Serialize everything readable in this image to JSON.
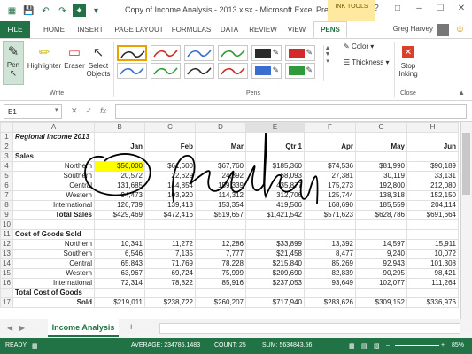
{
  "title_bar": {
    "doc_title": "Copy of Income Analysis - 2013.xlsx - Microsoft Excel Preview",
    "ink_tools": "INK TOOLS",
    "help": "?",
    "minimize": "–",
    "restore": "☐",
    "close": "✕"
  },
  "tabs": [
    "FILE",
    "HOME",
    "INSERT",
    "PAGE LAYOUT",
    "FORMULAS",
    "DATA",
    "REVIEW",
    "VIEW",
    "PENS"
  ],
  "user": "Greg Harvey",
  "ribbon": {
    "pen": "Pen",
    "highlighter": "Highlighter",
    "eraser": "Eraser",
    "select_objects_1": "Select",
    "select_objects_2": "Objects",
    "write_group": "Write",
    "pens_group": "Pens",
    "color": "Color",
    "thickness": "Thickness",
    "stop_inking_1": "Stop",
    "stop_inking_2": "Inking",
    "close_group": "Close",
    "pen_colors": [
      "#2b2b2b",
      "#d22a2a",
      "#3a6fd0",
      "#2e9a3a",
      "#2b2b2b",
      "#d22a2a",
      "#3a6fd0",
      "#2e9a3a",
      "#2b2b2b",
      "#d22a2a",
      "#3a6fd0",
      "#2e9a3a",
      "#ffff00",
      "#00e5ff",
      "#ff00ff",
      "#00e000",
      "#ff0000"
    ]
  },
  "formula_bar": {
    "name_box": "E1",
    "cancel": "✕",
    "enter": "✓",
    "fx": "fx"
  },
  "grid": {
    "columns": [
      "A",
      "B",
      "C",
      "D",
      "E",
      "F",
      "G",
      "H"
    ],
    "rows": [
      {
        "n": "1",
        "cells": [
          "Regional Income 2013",
          "",
          "",
          "",
          "",
          "",
          "",
          ""
        ]
      },
      {
        "n": "2",
        "cells": [
          "",
          "Jan",
          "Feb",
          "Mar",
          "Qtr 1",
          "Apr",
          "May",
          "Jun"
        ]
      },
      {
        "n": "3",
        "cells": [
          "Sales",
          "",
          "",
          "",
          "",
          "",
          "",
          ""
        ]
      },
      {
        "n": "4",
        "cells": [
          "Northern",
          "$56,000",
          "$61,600",
          "$67,760",
          "$185,360",
          "$74,536",
          "$81,990",
          "$90,189"
        ]
      },
      {
        "n": "5",
        "cells": [
          "Southern",
          "20,572",
          "22,629",
          "24,892",
          "68,093",
          "27,381",
          "30,119",
          "33,131"
        ]
      },
      {
        "n": "6",
        "cells": [
          "Central",
          "131,685",
          "144,854",
          "159,339",
          "435,877",
          "175,273",
          "192,800",
          "212,080"
        ]
      },
      {
        "n": "7",
        "cells": [
          "Western",
          "94,473",
          "103,920",
          "114,312",
          "312,706",
          "125,744",
          "138,318",
          "152,150"
        ]
      },
      {
        "n": "8",
        "cells": [
          "International",
          "126,739",
          "139,413",
          "153,354",
          "419,506",
          "168,690",
          "185,559",
          "204,114"
        ]
      },
      {
        "n": "9",
        "cells": [
          "Total Sales",
          "$429,469",
          "$472,416",
          "$519,657",
          "$1,421,542",
          "$571,623",
          "$628,786",
          "$691,664"
        ]
      },
      {
        "n": "10",
        "cells": [
          "",
          "",
          "",
          "",
          "",
          "",
          "",
          ""
        ]
      },
      {
        "n": "11",
        "cells": [
          "Cost of Goods Sold",
          "",
          "",
          "",
          "",
          "",
          "",
          ""
        ]
      },
      {
        "n": "12",
        "cells": [
          "Northern",
          "10,341",
          "11,272",
          "12,286",
          "$33,899",
          "13,392",
          "14,597",
          "15,911"
        ]
      },
      {
        "n": "13",
        "cells": [
          "Southern",
          "6,546",
          "7,135",
          "7,777",
          "$21,458",
          "8,477",
          "9,240",
          "10,072"
        ]
      },
      {
        "n": "14",
        "cells": [
          "Central",
          "65,843",
          "71,769",
          "78,228",
          "$215,840",
          "85,269",
          "92,943",
          "101,308"
        ]
      },
      {
        "n": "15",
        "cells": [
          "Western",
          "63,967",
          "69,724",
          "75,999",
          "$209,690",
          "82,839",
          "90,295",
          "98,421"
        ]
      },
      {
        "n": "16",
        "cells": [
          "International",
          "72,314",
          "78,822",
          "85,916",
          "$237,053",
          "93,649",
          "102,077",
          "111,264"
        ]
      },
      {
        "n": "17a",
        "cells": [
          "Total Cost of Goods",
          "",
          "",
          "",
          "",
          "",
          "",
          ""
        ]
      },
      {
        "n": "17",
        "cells": [
          "Sold",
          "$219,011",
          "$238,722",
          "$260,207",
          "$717,940",
          "$283,626",
          "$309,152",
          "$336,976"
        ]
      }
    ]
  },
  "sheet": {
    "name": "Income Analysis",
    "add": "+",
    "nav_prev": "◀",
    "nav_next": "▶"
  },
  "status": {
    "ready": "READY",
    "average": "AVERAGE: 234785.1483",
    "count": "COUNT: 25",
    "sum": "SUM: 5634843.56",
    "zoom": "85%"
  }
}
